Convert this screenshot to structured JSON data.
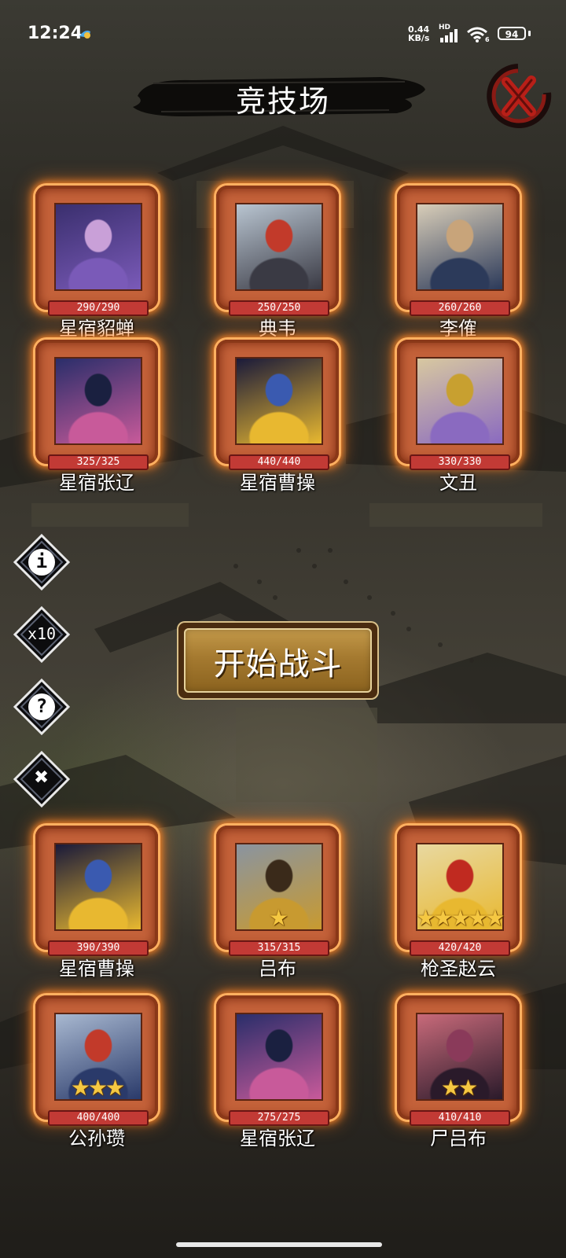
{
  "status_bar": {
    "time": "12:24",
    "net_speed": "0.44",
    "net_unit": "KB/s",
    "hd": "HD",
    "signal_label": "6",
    "battery": "94"
  },
  "title": "竞技场",
  "heroes_enemy": [
    {
      "hp": "290/290",
      "name": "星宿貂蝉",
      "stars": "",
      "palette": [
        "#3a2f6e",
        "#7a5ab8",
        "#c9a0d8"
      ]
    },
    {
      "hp": "250/250",
      "name": "典韦",
      "stars": "",
      "palette": [
        "#b8c4d0",
        "#3a3a44",
        "#c23a2a"
      ]
    },
    {
      "hp": "260/260",
      "name": "李傕",
      "stars": "",
      "palette": [
        "#d8cdb8",
        "#2c3a5a",
        "#c8a47a"
      ]
    },
    {
      "hp": "325/325",
      "name": "星宿张辽",
      "stars": "",
      "palette": [
        "#2a2e6a",
        "#c85a9a",
        "#1a2040"
      ]
    },
    {
      "hp": "440/440",
      "name": "星宿曹操",
      "stars": "",
      "palette": [
        "#1a1a3a",
        "#e8b830",
        "#3a5ab0"
      ]
    },
    {
      "hp": "330/330",
      "name": "文丑",
      "stars": "",
      "palette": [
        "#d8c8a0",
        "#8a6ac0",
        "#c8a030"
      ]
    }
  ],
  "start_button": "开始战斗",
  "side_buttons": [
    {
      "name": "info",
      "label": "i"
    },
    {
      "name": "x10",
      "label": "x10"
    },
    {
      "name": "help",
      "label": "?"
    },
    {
      "name": "close",
      "label": "✖"
    }
  ],
  "heroes_player": [
    {
      "hp": "390/390",
      "name": "星宿曹操",
      "stars": "",
      "palette": [
        "#1a1a3a",
        "#e8b830",
        "#3a5ab0"
      ]
    },
    {
      "hp": "315/315",
      "name": "吕布",
      "stars": "★",
      "palette": [
        "#8a94a0",
        "#c89a30",
        "#3a2a1a"
      ]
    },
    {
      "hp": "420/420",
      "name": "枪圣赵云",
      "stars": "★★★★★",
      "palette": [
        "#e8d8a0",
        "#e8b830",
        "#c02a20"
      ]
    },
    {
      "hp": "400/400",
      "name": "公孙瓒",
      "stars": "★★★",
      "palette": [
        "#a8b8d0",
        "#2a3a6a",
        "#c23a2a"
      ]
    },
    {
      "hp": "275/275",
      "name": "星宿张辽",
      "stars": "",
      "palette": [
        "#2a2e6a",
        "#c85a9a",
        "#1a2040"
      ]
    },
    {
      "hp": "410/410",
      "name": "尸吕布",
      "stars": "★★",
      "palette": [
        "#c86a7a",
        "#2a1a2a",
        "#8a3a5a"
      ]
    }
  ],
  "colors": {
    "frame": "#c4623a",
    "glow": "#ff8a2a",
    "hp_bar": "#c23a35",
    "star": "#f5c842",
    "button_gold": "#a57a30"
  }
}
